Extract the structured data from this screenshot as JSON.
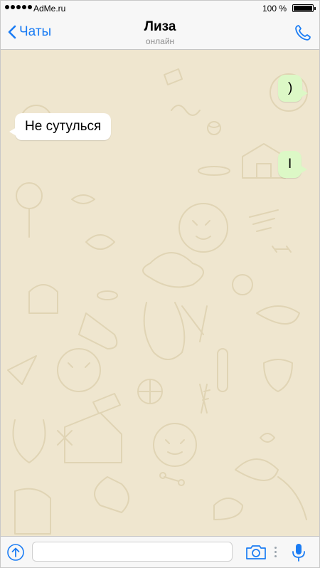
{
  "status_bar": {
    "carrier": "AdMe.ru",
    "battery_text": "100 %",
    "battery_level": 1.0
  },
  "nav": {
    "back_label": "Чаты",
    "contact_name": "Лиза",
    "contact_status": "онлайн",
    "back_icon": "chevron-left-icon",
    "call_icon": "phone-icon"
  },
  "messages": [
    {
      "direction": "outgoing",
      "text": ")"
    },
    {
      "direction": "incoming",
      "text": "Не сутулься"
    },
    {
      "direction": "outgoing",
      "text": "I"
    }
  ],
  "input_bar": {
    "message_value": "",
    "upload_icon": "arrow-up-circle-icon",
    "camera_icon": "camera-icon",
    "mic_icon": "microphone-icon"
  },
  "colors": {
    "accent": "#1a7cf4",
    "chat_background": "#efe6cf",
    "outgoing_bubble": "#dcf8c6",
    "incoming_bubble": "#ffffff"
  }
}
